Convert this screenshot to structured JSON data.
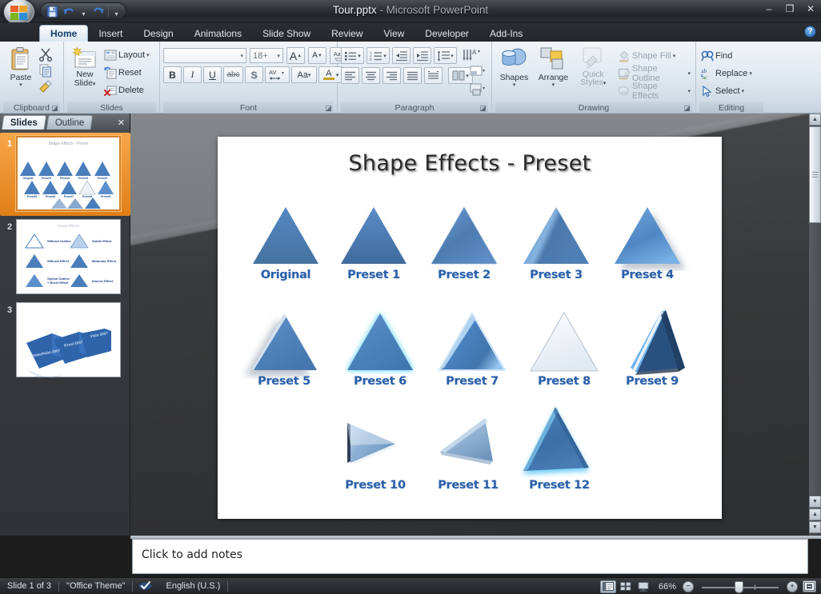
{
  "window": {
    "file_name": "Tour.pptx",
    "app_name": "Microsoft PowerPoint",
    "separator": " - ",
    "minimize": "–",
    "restore": "❐",
    "close": "✕"
  },
  "quick_access": {
    "save": "save-icon",
    "undo": "undo-icon",
    "undo_dropdown": "▾",
    "redo": "redo-icon",
    "customize": "▾"
  },
  "tabs": [
    {
      "label": "Home",
      "active": true
    },
    {
      "label": "Insert",
      "active": false
    },
    {
      "label": "Design",
      "active": false
    },
    {
      "label": "Animations",
      "active": false
    },
    {
      "label": "Slide Show",
      "active": false
    },
    {
      "label": "Review",
      "active": false
    },
    {
      "label": "View",
      "active": false
    },
    {
      "label": "Developer",
      "active": false
    },
    {
      "label": "Add-Ins",
      "active": false
    }
  ],
  "help": "?",
  "ribbon": {
    "clipboard": {
      "group_label": "Clipboard",
      "paste": "Paste",
      "paste_caret": "▾",
      "cut": "cut-icon",
      "copy": "copy-icon",
      "format_painter": "format-painter-icon",
      "launcher": "◪"
    },
    "slides": {
      "group_label": "Slides",
      "new_slide_line1": "New",
      "new_slide_line2": "Slide",
      "new_slide_caret": "▾",
      "layout": "Layout",
      "layout_caret": "▾",
      "reset": "Reset",
      "delete": "Delete"
    },
    "font": {
      "group_label": "Font",
      "font_name": "",
      "font_size": "18+",
      "grow_font": "A",
      "shrink_font": "A",
      "clear_formatting": "clear-formatting-icon",
      "bold": "B",
      "italic": "I",
      "underline": "U",
      "strikethrough": "abc",
      "shadow": "S",
      "char_spacing": "AV",
      "change_case": "Aa",
      "font_color": "A",
      "launcher": "◪"
    },
    "paragraph": {
      "group_label": "Paragraph",
      "bullets": "bullets-icon",
      "numbering": "numbering-icon",
      "decrease_indent": "decrease-indent-icon",
      "increase_indent": "increase-indent-icon",
      "line_spacing": "line-spacing-icon",
      "text_direction": "text-direction-icon",
      "align_text": "align-text-icon",
      "convert_smartart": "smartart-icon",
      "align_left": "align-left-icon",
      "align_center": "align-center-icon",
      "align_right": "align-right-icon",
      "justify": "justify-icon",
      "columns": "columns-icon",
      "launcher": "◪"
    },
    "drawing": {
      "group_label": "Drawing",
      "shapes": "Shapes",
      "shapes_caret": "▾",
      "arrange": "Arrange",
      "arrange_caret": "▾",
      "quick_styles_line1": "Quick",
      "quick_styles_line2": "Styles",
      "quick_styles_caret": "▾",
      "shape_fill": "Shape Fill",
      "shape_outline": "Shape Outline",
      "shape_effects": "Shape Effects",
      "caret": "▾",
      "launcher": "◪"
    },
    "editing": {
      "group_label": "Editing",
      "find": "Find",
      "replace": "Replace",
      "replace_caret": "▾",
      "select": "Select",
      "select_caret": "▾"
    }
  },
  "slide_panel": {
    "tab_slides": "Slides",
    "tab_outline": "Outline",
    "close": "✕",
    "thumbnails": [
      {
        "number": "1",
        "selected": true,
        "kind": "presets"
      },
      {
        "number": "2",
        "selected": false,
        "kind": "effects"
      },
      {
        "number": "3",
        "selected": false,
        "kind": "folders"
      }
    ],
    "thumb2_labels": [
      "Without Outline",
      "Subtle Effect",
      "Without Effect",
      "Moderate Effect",
      "Stylish Outline + Bevel Effect",
      "Intense Effect"
    ],
    "thumb3_labels": [
      "PowerPoint 2007",
      "Excel 2007",
      "Visio 2007"
    ]
  },
  "slide": {
    "title": "Shape Effects - Preset",
    "shapes": [
      {
        "label": "Original",
        "row": 0,
        "col": 0,
        "style": "plain"
      },
      {
        "label": "Preset 1",
        "row": 0,
        "col": 1,
        "style": "glow-white"
      },
      {
        "label": "Preset 2",
        "row": 0,
        "col": 2,
        "style": "soft-bevel"
      },
      {
        "label": "Preset 3",
        "row": 0,
        "col": 3,
        "style": "shine"
      },
      {
        "label": "Preset 4",
        "row": 0,
        "col": 4,
        "style": "light-shadow"
      },
      {
        "label": "Preset 5",
        "row": 1,
        "col": 0,
        "style": "drop-shadow"
      },
      {
        "label": "Preset 6",
        "row": 1,
        "col": 1,
        "style": "cyan-glow"
      },
      {
        "label": "Preset 7",
        "row": 1,
        "col": 2,
        "style": "inner-bevel"
      },
      {
        "label": "Preset 8",
        "row": 1,
        "col": 3,
        "style": "pale"
      },
      {
        "label": "Preset 9",
        "row": 1,
        "col": 4,
        "style": "rotate-3d-dark"
      },
      {
        "label": "Preset 10",
        "row": 2,
        "col": 1,
        "style": "rotate-left"
      },
      {
        "label": "Preset 11",
        "row": 2,
        "col": 2,
        "style": "rotate-tilt"
      },
      {
        "label": "Preset 12",
        "row": 2,
        "col": 3,
        "style": "bottom-glow"
      }
    ]
  },
  "notes": {
    "placeholder": "Click to add notes"
  },
  "status": {
    "slide_counter": "Slide 1 of 3",
    "theme": "\"Office Theme\"",
    "spellcheck_icon": "spellcheck-icon",
    "language": "English (U.S.)",
    "view_normal": "normal-view-icon",
    "view_sorter": "slide-sorter-icon",
    "view_show": "slide-show-icon",
    "zoom_level": "66%",
    "zoom_out": "−",
    "zoom_in": "+",
    "fit_window": "fit-to-window-icon"
  },
  "colors": {
    "accent_blue": "#2b5fa8",
    "shape_blue": "#4a7ebb",
    "ribbon_bg": "#e2eaf1",
    "title_bar": "#30343a",
    "selection_orange": "#e07f18"
  }
}
